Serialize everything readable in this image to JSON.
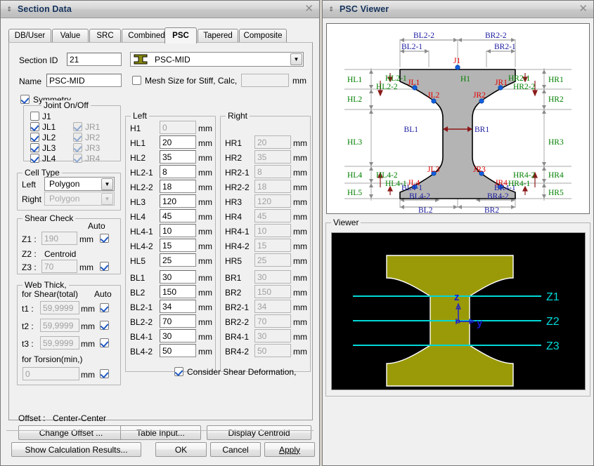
{
  "section_data_window": {
    "title": "Section Data",
    "close_label": "✕",
    "grip_label": "⇕",
    "tabs": [
      {
        "label": "DB/User",
        "active": false
      },
      {
        "label": "Value",
        "active": false
      },
      {
        "label": "SRC",
        "active": false
      },
      {
        "label": "Combined",
        "active": false
      },
      {
        "label": "PSC",
        "active": true
      },
      {
        "label": "Tapered",
        "active": false
      },
      {
        "label": "Composite",
        "active": false
      }
    ],
    "section_id": {
      "label": "Section ID",
      "value": "21"
    },
    "shape_combo": {
      "value": "PSC-MID",
      "arrow": "▼"
    },
    "name": {
      "label": "Name",
      "value": "PSC-MID"
    },
    "mesh_size": {
      "label": "Mesh Size for Stiff, Calc,",
      "checked": false,
      "value": "",
      "unit": "mm"
    },
    "symmetry": {
      "label": "Symmetry",
      "checked": true
    },
    "joint_on_off": {
      "title": "Joint On/Off",
      "items": [
        {
          "label": "J1",
          "checked": false,
          "disabled": false
        },
        {
          "label": "JL1",
          "checked": true,
          "disabled": false
        },
        {
          "label": "JL2",
          "checked": true,
          "disabled": false
        },
        {
          "label": "JL3",
          "checked": true,
          "disabled": false
        },
        {
          "label": "JL4",
          "checked": true,
          "disabled": false
        },
        {
          "label": "JR1",
          "checked": true,
          "disabled": true
        },
        {
          "label": "JR2",
          "checked": true,
          "disabled": true
        },
        {
          "label": "JR3",
          "checked": true,
          "disabled": true
        },
        {
          "label": "JR4",
          "checked": true,
          "disabled": true
        }
      ]
    },
    "cell_type": {
      "title": "Cell Type",
      "left_label": "Left",
      "left_value": "Polygon",
      "right_label": "Right",
      "right_value": "Polygon",
      "arrow": "▼"
    },
    "shear_check": {
      "title": "Shear Check",
      "auto_label": "Auto",
      "rows": [
        {
          "label": "Z1 :",
          "value": "190",
          "unit": "mm",
          "auto": true,
          "readonly": true,
          "has_field": true
        },
        {
          "label": "Z2 :",
          "value": "Centroid",
          "unit": "",
          "auto": false,
          "readonly": true,
          "has_field": false
        },
        {
          "label": "Z3 :",
          "value": "70",
          "unit": "mm",
          "auto": true,
          "readonly": true,
          "has_field": true
        }
      ]
    },
    "web_thick": {
      "title": "Web Thick,",
      "subtitle": "for Shear(total)",
      "auto_label": "Auto",
      "rows": [
        {
          "label": "t1 :",
          "value": "59,9999",
          "unit": "mm",
          "auto": true
        },
        {
          "label": "t2 :",
          "value": "59,9999",
          "unit": "mm",
          "auto": true
        },
        {
          "label": "t3 :",
          "value": "59,9999",
          "unit": "mm",
          "auto": true
        }
      ],
      "torsion_label": "for Torsion(min,)",
      "torsion_value": "0",
      "torsion_unit": "mm",
      "torsion_auto": true
    },
    "left_group": {
      "title": "Left",
      "rows": [
        {
          "label": "H1",
          "value": "0",
          "unit": "mm",
          "readonly": true
        },
        {
          "label": "HL1",
          "value": "20",
          "unit": "mm",
          "readonly": false
        },
        {
          "label": "HL2",
          "value": "35",
          "unit": "mm",
          "readonly": false
        },
        {
          "label": "HL2-1",
          "value": "8",
          "unit": "mm",
          "readonly": false
        },
        {
          "label": "HL2-2",
          "value": "18",
          "unit": "mm",
          "readonly": false
        },
        {
          "label": "HL3",
          "value": "120",
          "unit": "mm",
          "readonly": false
        },
        {
          "label": "HL4",
          "value": "45",
          "unit": "mm",
          "readonly": false
        },
        {
          "label": "HL4-1",
          "value": "10",
          "unit": "mm",
          "readonly": false
        },
        {
          "label": "HL4-2",
          "value": "15",
          "unit": "mm",
          "readonly": false
        },
        {
          "label": "HL5",
          "value": "25",
          "unit": "mm",
          "readonly": false
        },
        {
          "label": "BL1",
          "value": "30",
          "unit": "mm",
          "readonly": false
        },
        {
          "label": "BL2",
          "value": "150",
          "unit": "mm",
          "readonly": false
        },
        {
          "label": "BL2-1",
          "value": "34",
          "unit": "mm",
          "readonly": false
        },
        {
          "label": "BL2-2",
          "value": "70",
          "unit": "mm",
          "readonly": false
        },
        {
          "label": "BL4-1",
          "value": "30",
          "unit": "mm",
          "readonly": false
        },
        {
          "label": "BL4-2",
          "value": "50",
          "unit": "mm",
          "readonly": false
        }
      ]
    },
    "right_group": {
      "title": "Right",
      "rows": [
        {
          "label": "",
          "value": "",
          "unit": "",
          "readonly": true,
          "blank": true
        },
        {
          "label": "HR1",
          "value": "20",
          "unit": "mm",
          "readonly": true
        },
        {
          "label": "HR2",
          "value": "35",
          "unit": "mm",
          "readonly": true
        },
        {
          "label": "HR2-1",
          "value": "8",
          "unit": "mm",
          "readonly": true
        },
        {
          "label": "HR2-2",
          "value": "18",
          "unit": "mm",
          "readonly": true
        },
        {
          "label": "HR3",
          "value": "120",
          "unit": "mm",
          "readonly": true
        },
        {
          "label": "HR4",
          "value": "45",
          "unit": "mm",
          "readonly": true
        },
        {
          "label": "HR4-1",
          "value": "10",
          "unit": "mm",
          "readonly": true
        },
        {
          "label": "HR4-2",
          "value": "15",
          "unit": "mm",
          "readonly": true
        },
        {
          "label": "HR5",
          "value": "25",
          "unit": "mm",
          "readonly": true
        },
        {
          "label": "BR1",
          "value": "30",
          "unit": "mm",
          "readonly": true
        },
        {
          "label": "BR2",
          "value": "150",
          "unit": "mm",
          "readonly": true
        },
        {
          "label": "BR2-1",
          "value": "34",
          "unit": "mm",
          "readonly": true
        },
        {
          "label": "BR2-2",
          "value": "70",
          "unit": "mm",
          "readonly": true
        },
        {
          "label": "BR4-1",
          "value": "30",
          "unit": "mm",
          "readonly": true
        },
        {
          "label": "BR4-2",
          "value": "50",
          "unit": "mm",
          "readonly": true
        }
      ]
    },
    "consider_shear": {
      "label": "Consider Shear Deformation,",
      "checked": true
    },
    "offset": {
      "label": "Offset :",
      "value": "Center-Center"
    },
    "buttons": {
      "change_offset": "Change Offset ...",
      "table_input": "Table Input...",
      "display_centroid": "Display Centroid",
      "show_calc": "Show Calculation Results...",
      "ok": "OK",
      "cancel": "Cancel",
      "apply": "Apply"
    }
  },
  "psc_viewer_window": {
    "title": "PSC Viewer",
    "close_label": "✕",
    "grip_label": "⇕",
    "viewer_group_title": "Viewer",
    "diagram": {
      "dimension_labels_blue": [
        "BL2-2",
        "BR2-2",
        "BL2-1",
        "BR2-1",
        "BL1",
        "BR1",
        "BL4-1",
        "BR4-1",
        "BL4-2",
        "BR4-2",
        "BL2",
        "BR2"
      ],
      "height_labels_green": [
        "HL1",
        "HL2",
        "HL2-1",
        "HL2-2",
        "HL3",
        "HL4",
        "HL4-1",
        "HL4-2",
        "HL5",
        "H1",
        "HR1",
        "HR2",
        "HR2-1",
        "HR2-2",
        "HR3",
        "HR4",
        "HR4-1",
        "HR4-2",
        "HR5"
      ],
      "joint_labels_red": [
        "J1",
        "JL1",
        "JL2",
        "JL3",
        "JL4",
        "JR1",
        "JR2",
        "JR3",
        "JR4"
      ]
    },
    "viewer": {
      "axis_z": "z",
      "axis_y": "y",
      "z_lines": [
        "Z1",
        "Z2",
        "Z3"
      ]
    }
  },
  "colors": {
    "accent_blue": "#1a1aa0",
    "label_green": "#008000",
    "label_red": "#e00000",
    "joint_dot": "#1060e0",
    "section_fill": "#b4b4b4",
    "viewer_fill": "#9a9a08",
    "viewer_line": "#00d8d8",
    "dim_line": "#8b8b8b",
    "arrow_dark_red": "#8b1a1a"
  }
}
